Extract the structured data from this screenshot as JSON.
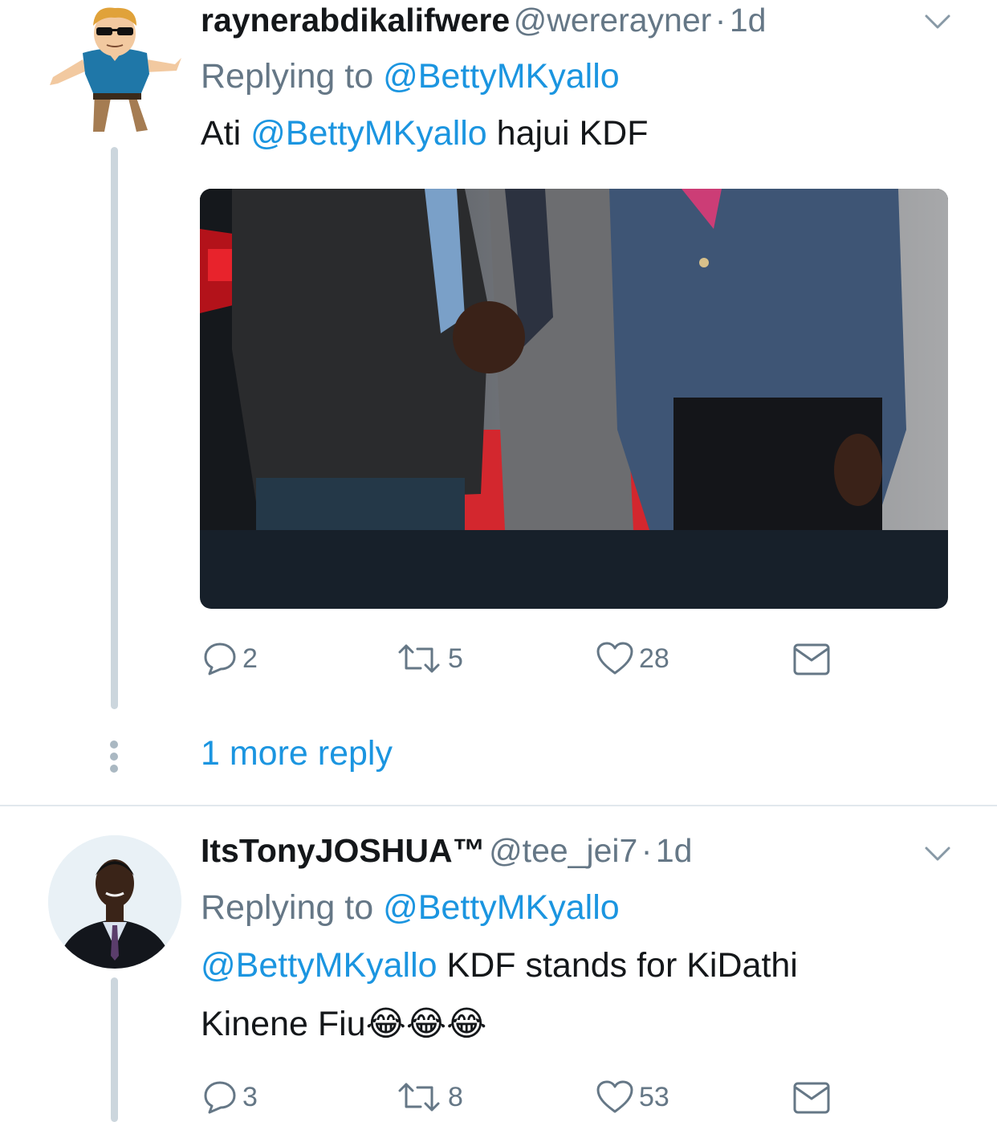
{
  "tweets": [
    {
      "display_name": "raynerabdikalifwere",
      "handle": "@wererayner",
      "separator": "·",
      "time": "1d",
      "replying_prefix": "Replying to",
      "replying_handle": "@BettyMKyallo",
      "text_parts": [
        "Ati",
        "@BettyMKyallo",
        "hajui KDF"
      ],
      "has_media": true,
      "actions": {
        "replies": "2",
        "retweets": "5",
        "likes": "28"
      }
    },
    {
      "display_name": "ItsTonyJOSHUA™",
      "handle": "@tee_jei7",
      "separator": "·",
      "time": "1d",
      "replying_prefix": "Replying to",
      "replying_handle": "@BettyMKyallo",
      "text_parts": [
        "@BettyMKyallo",
        "KDF stands for KiDathi",
        "Kinene Fiu",
        "😂😂😂"
      ],
      "actions": {
        "replies": "3",
        "retweets": "8",
        "likes": "53"
      }
    }
  ],
  "more_replies_label": "1 more reply",
  "icons": {
    "caret": "chevron-down-icon",
    "reply": "reply-bubble-icon",
    "retweet": "retweet-icon",
    "like": "heart-icon",
    "dm": "envelope-icon"
  },
  "colors": {
    "link": "#1b95e0",
    "muted": "#657786",
    "thread_line": "#ccd6dd",
    "divider": "#e1e8ed"
  }
}
